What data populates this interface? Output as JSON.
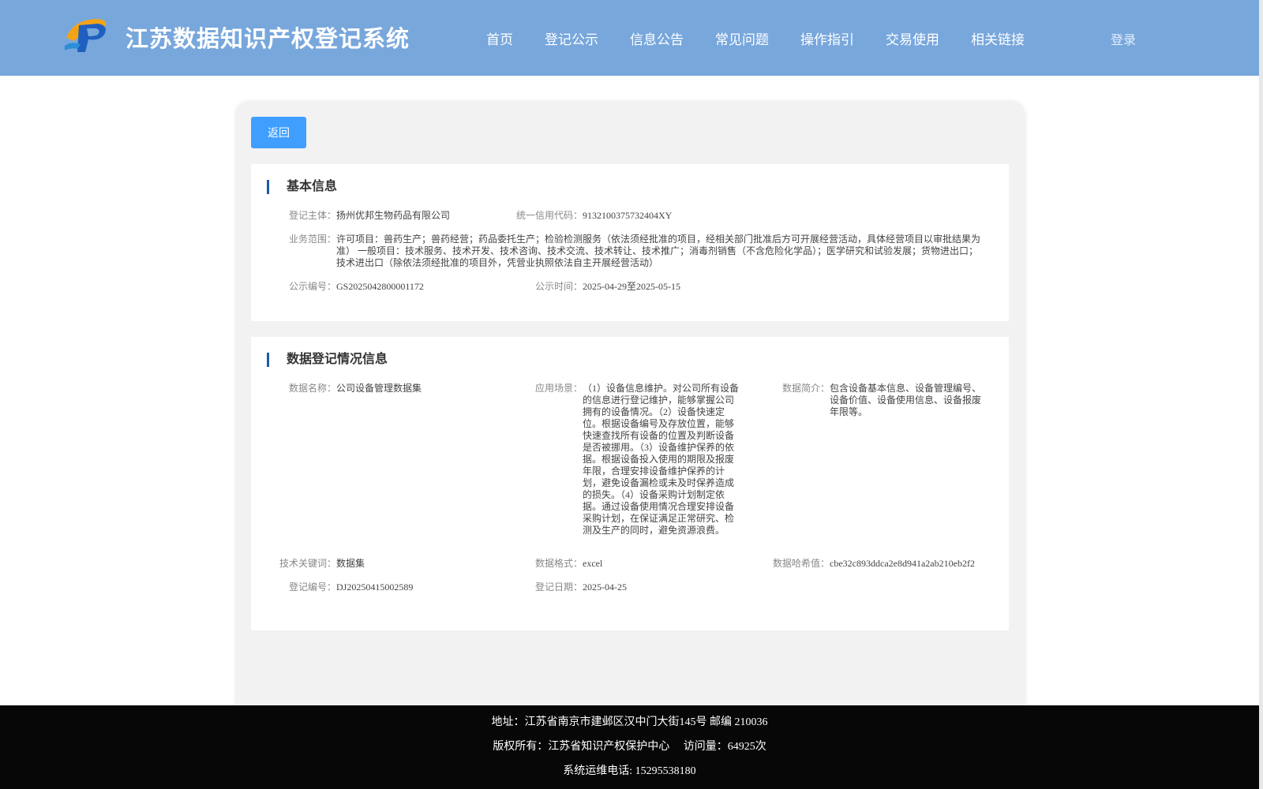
{
  "header": {
    "title": "江苏数据知识产权登记系统",
    "nav": [
      "首页",
      "登记公示",
      "信息公告",
      "常见问题",
      "操作指引",
      "交易使用",
      "相关链接"
    ],
    "login": "登录"
  },
  "back_label": "返回",
  "basic": {
    "section_title": "基本信息",
    "subject_label": "登记主体：",
    "subject_value": "扬州优邦生物药品有限公司",
    "credit_label": "统一信用代码：",
    "credit_value": "9132100375732404XY",
    "scope_label": "业务范围：",
    "scope_value": "许可项目：兽药生产；兽药经营；药品委托生产；检验检测服务（依法须经批准的项目，经相关部门批准后方可开展经营活动，具体经营项目以审批结果为准） 一般项目：技术服务、技术开发、技术咨询、技术交流、技术转让、技术推广；消毒剂销售（不含危险化学品）；医学研究和试验发展；货物进出口；技术进出口（除依法须经批准的项目外，凭营业执照依法自主开展经营活动）",
    "pub_no_label": "公示编号：",
    "pub_no_value": "GS2025042800001172",
    "pub_time_label": "公示时间：",
    "pub_time_value": "2025-04-29至2025-05-15"
  },
  "data_reg": {
    "section_title": "数据登记情况信息",
    "name_label": "数据名称：",
    "name_value": "公司设备管理数据集",
    "scene_label": "应用场景：",
    "scene_value": "（1）设备信息维护。对公司所有设备的信息进行登记维护，能够掌握公司拥有的设备情况。（2）设备快速定位。根据设备编号及存放位置，能够快速查找所有设备的位置及判断设备是否被挪用。（3）设备维护保养的依据。根据设备投入使用的期限及报废年限，合理安排设备维护保养的计划，避免设备漏检或未及时保养造成的损失。（4）设备采购计划制定依据。通过设备使用情况合理安排设备采购计划，在保证满足正常研究、检测及生产的同时，避免资源浪费。",
    "intro_label": "数据简介：",
    "intro_value": "包含设备基本信息、设备管理编号、设备价值、设备使用信息、设备报废年限等。",
    "keyword_label": "技术关键词：",
    "keyword_value": "数据集",
    "format_label": "数据格式：",
    "format_value": "excel",
    "hash_label": "数据哈希值：",
    "hash_value": "cbe32c893ddca2e8d941a2ab210eb2f2",
    "reg_no_label": "登记编号：",
    "reg_no_value": "DJ20250415002589",
    "reg_date_label": "登记日期：",
    "reg_date_value": "2025-04-25"
  },
  "footer": {
    "address": "地址：江苏省南京市建邺区汉中门大街145号 邮编 210036",
    "copyright": "版权所有：江苏省知识产权保护中心　 访问量：64925次",
    "phone": "系统运维电话: 15295538180"
  }
}
